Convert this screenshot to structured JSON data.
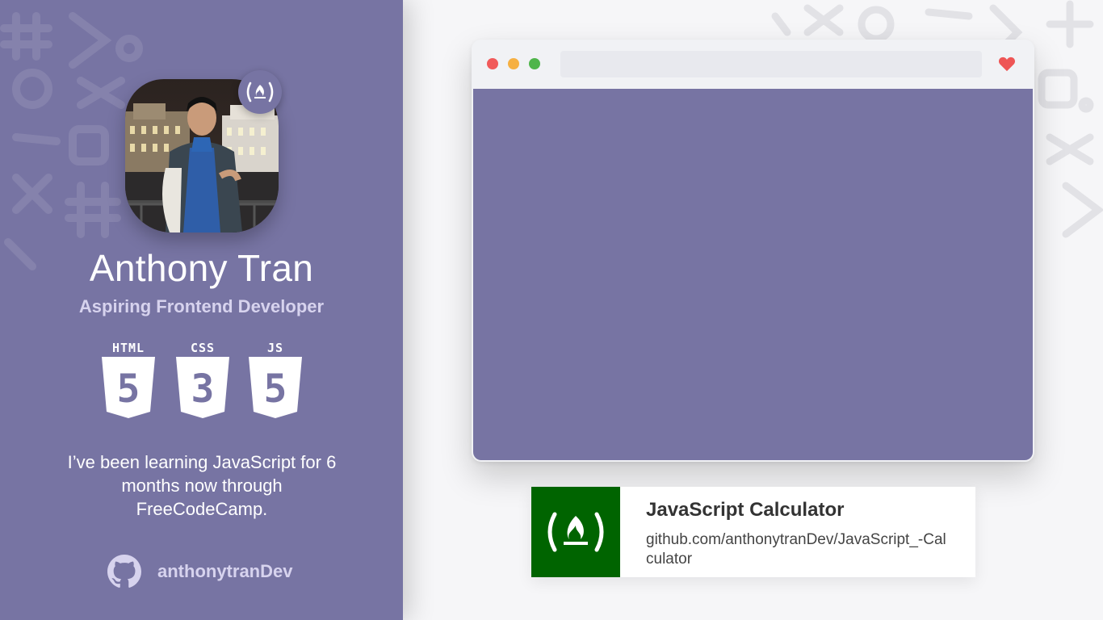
{
  "profile": {
    "name": "Anthony Tran",
    "role": "Aspiring Frontend Developer",
    "bio": "I’ve been learning JavaScript for 6 months now through FreeCodeCamp.",
    "github_username": "anthonytranDev"
  },
  "tech": [
    {
      "label": "HTML",
      "number": "5",
      "icon": "html5-shield-icon"
    },
    {
      "label": "CSS",
      "number": "3",
      "icon": "css3-shield-icon"
    },
    {
      "label": "JS",
      "number": "5",
      "icon": "js-shield-icon"
    }
  ],
  "project": {
    "title": "JavaScript Calculator",
    "link": "github.com/anthonytranDev/JavaScript_-Calculator"
  },
  "colors": {
    "panel": "#7774a3",
    "role_text": "#d7d3ee",
    "fcc_green": "#006400",
    "dot_red": "#f15a5a",
    "dot_yellow": "#f6b042",
    "dot_green": "#4fb54a",
    "heart": "#ee5555"
  }
}
